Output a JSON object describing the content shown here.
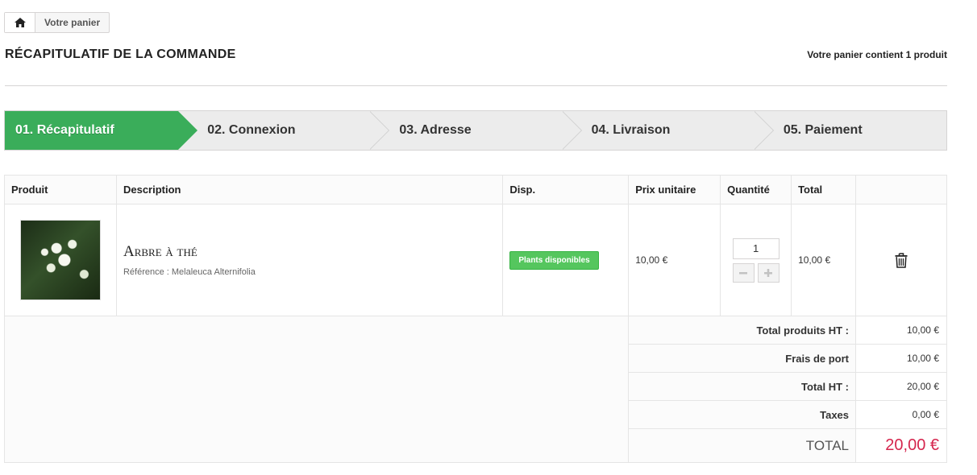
{
  "breadcrumb": {
    "home_icon": "home-icon",
    "current": "Votre panier"
  },
  "header": {
    "title": "RÉCAPITULATIF DE LA COMMANDE",
    "cart_count": "Votre panier contient 1 produit"
  },
  "steps": [
    {
      "label": "01. Récapitulatif",
      "active": true
    },
    {
      "label": "02. Connexion"
    },
    {
      "label": "03. Adresse"
    },
    {
      "label": "04. Livraison"
    },
    {
      "label": "05. Paiement"
    }
  ],
  "colors": {
    "step_active": "#3aad5a",
    "availability_badge": "#55c65e",
    "total_price": "#d5254d"
  },
  "table": {
    "headers": {
      "product": "Produit",
      "description": "Description",
      "availability": "Disp.",
      "unit_price": "Prix unitaire",
      "quantity": "Quantité",
      "total": "Total"
    },
    "items": [
      {
        "name": "Arbre à thé",
        "reference": "Référence : Melaleuca Alternifolia",
        "availability": "Plants disponibles",
        "unit_price": "10,00 €",
        "quantity": "1",
        "total": "10,00 €",
        "delete_icon": "trash-icon"
      }
    ],
    "summary": {
      "products_ht_label": "Total produits HT :",
      "products_ht_value": "10,00 €",
      "shipping_label": "Frais de port",
      "shipping_value": "10,00 €",
      "total_ht_label": "Total HT :",
      "total_ht_value": "20,00 €",
      "taxes_label": "Taxes",
      "taxes_value": "0,00 €",
      "total_label": "TOTAL",
      "total_value": "20,00 €"
    }
  }
}
